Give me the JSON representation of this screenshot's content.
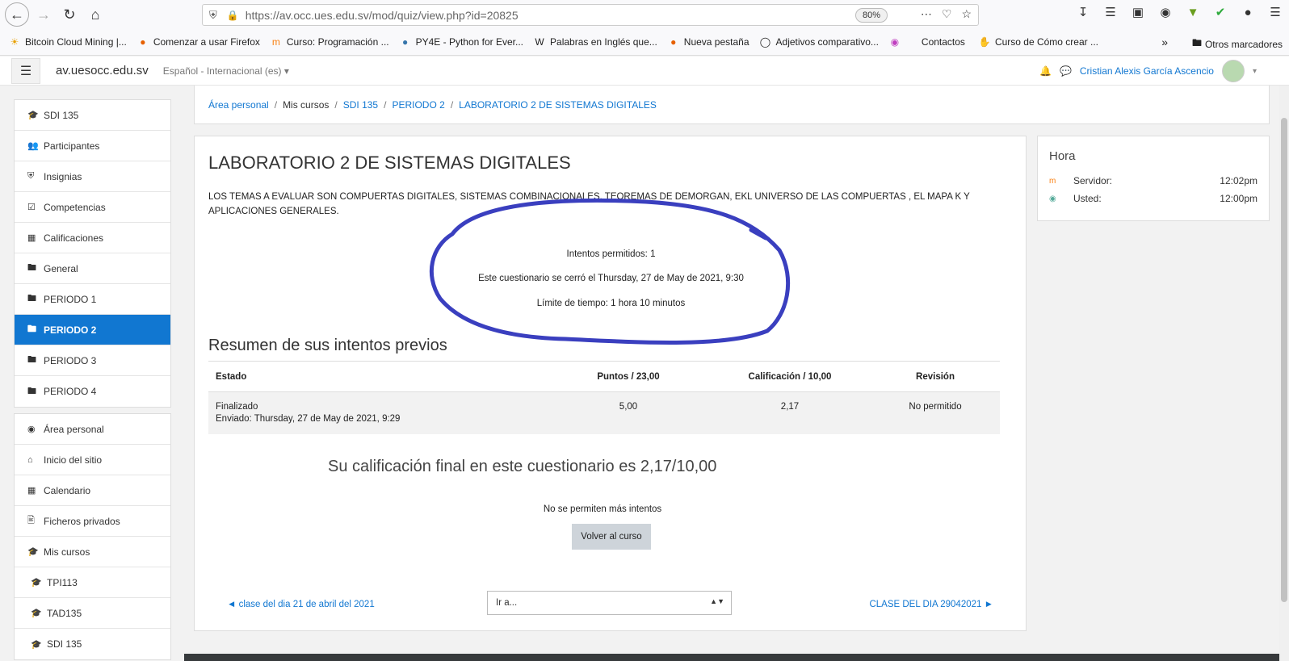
{
  "browser": {
    "url": "https://av.occ.ues.edu.sv/mod/quiz/view.php?id=20825",
    "zoom": "80%"
  },
  "bookmarks": [
    {
      "label": "Bitcoin Cloud Mining |...",
      "icon": "sun-icon"
    },
    {
      "label": "Comenzar a usar Firefox",
      "icon": "firefox-icon"
    },
    {
      "label": "Curso: Programación ...",
      "icon": "moodle-icon"
    },
    {
      "label": "PY4E - Python for Ever...",
      "icon": "python-icon"
    },
    {
      "label": "Palabras en Inglés que...",
      "icon": "w-icon"
    },
    {
      "label": "Nueva pestaña",
      "icon": "firefox-icon"
    },
    {
      "label": "Adjetivos comparativo...",
      "icon": "globe-icon"
    },
    {
      "label": "",
      "icon": "app-icon"
    },
    {
      "label": "Contactos",
      "icon": ""
    },
    {
      "label": "Curso de Cómo crear ...",
      "icon": "hand-icon"
    }
  ],
  "bookmarks_other": "Otros marcadores",
  "moodle": {
    "site_name": "av.uesocc.edu.sv",
    "language": "Español - Internacional (es)",
    "user_name": "Cristian Alexis García Ascencio"
  },
  "sidebar": {
    "group1": [
      {
        "label": "SDI 135",
        "icon": "graduation-cap-icon"
      },
      {
        "label": "Participantes",
        "icon": "users-icon"
      },
      {
        "label": "Insignias",
        "icon": "shield-icon"
      },
      {
        "label": "Competencias",
        "icon": "check-square-icon"
      },
      {
        "label": "Calificaciones",
        "icon": "table-icon"
      },
      {
        "label": "General",
        "icon": "folder-icon"
      },
      {
        "label": "PERIODO 1",
        "icon": "folder-icon"
      },
      {
        "label": "PERIODO 2",
        "icon": "folder-icon"
      },
      {
        "label": "PERIODO 3",
        "icon": "folder-icon"
      },
      {
        "label": "PERIODO 4",
        "icon": "folder-icon"
      }
    ],
    "group2": [
      {
        "label": "Área personal",
        "icon": "dashboard-icon"
      },
      {
        "label": "Inicio del sitio",
        "icon": "home-icon"
      },
      {
        "label": "Calendario",
        "icon": "calendar-icon"
      },
      {
        "label": "Ficheros privados",
        "icon": "file-icon"
      },
      {
        "label": "Mis cursos",
        "icon": "graduation-cap-icon"
      },
      {
        "label": "TPI113",
        "icon": "graduation-cap-icon"
      },
      {
        "label": "TAD135",
        "icon": "graduation-cap-icon"
      },
      {
        "label": "SDI 135",
        "icon": "graduation-cap-icon"
      }
    ]
  },
  "breadcrumb": {
    "items": [
      "Área personal",
      "Mis cursos",
      "SDI 135",
      "PERIODO 2",
      "LABORATORIO 2 DE SISTEMAS DIGITALES"
    ]
  },
  "quiz": {
    "title": "LABORATORIO 2 DE SISTEMAS DIGITALES",
    "description": "LOS TEMAS A EVALUAR SON COMPUERTAS DIGITALES, SISTEMAS COMBINACIONALES, TEOREMAS DE DEMORGAN, EKL UNIVERSO DE LAS COMPUERTAS , EL MAPA K Y APLICACIONES GENERALES.",
    "attempts_allowed": "Intentos permitidos: 1",
    "closed_on": "Este cuestionario se cerró el Thursday, 27 de May de 2021, 9:30",
    "time_limit": "Límite de tiempo: 1 hora 10 minutos",
    "summary_title": "Resumen de sus intentos previos",
    "table": {
      "headers": [
        "Estado",
        "Puntos / 23,00",
        "Calificación / 10,00",
        "Revisión"
      ],
      "rows": [
        {
          "state": "Finalizado",
          "submitted": "Enviado: Thursday, 27 de May de 2021, 9:29",
          "points": "5,00",
          "grade": "2,17",
          "review": "No permitido"
        }
      ]
    },
    "final_grade": "Su calificación final en este cuestionario es 2,17/10,00",
    "no_more_attempts": "No se permiten más intentos",
    "back_button": "Volver al curso",
    "prev_link": "◄ clase del dia 21 de abril del 2021",
    "jump_select": "Ir a...",
    "next_link": "CLASE DEL DIA 29042021 ►"
  },
  "time_block": {
    "title": "Hora",
    "server_label": "Servidor:",
    "server_time": "12:02pm",
    "user_label": "Usted:",
    "user_time": "12:00pm"
  },
  "colors": {
    "accent": "#1177d1",
    "annotation": "#3a3fbf"
  }
}
